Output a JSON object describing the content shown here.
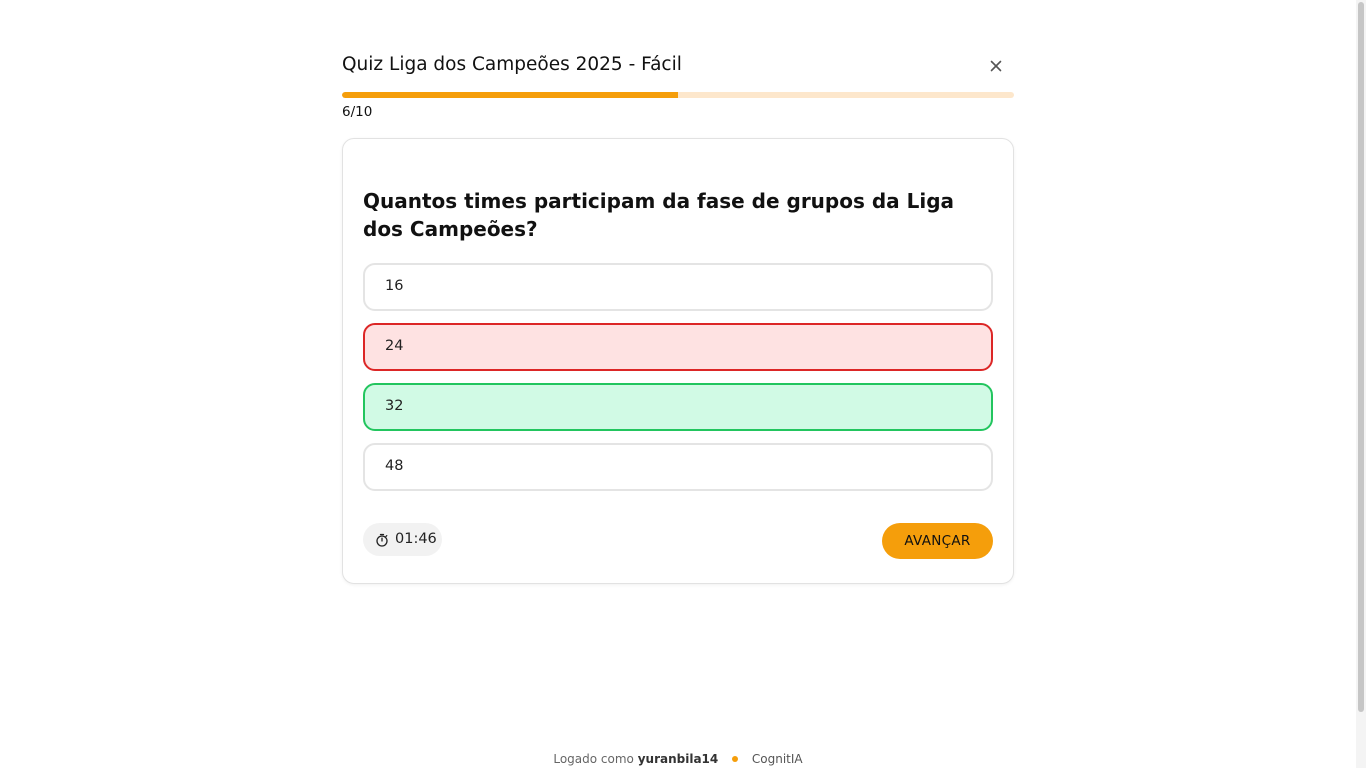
{
  "quiz": {
    "title": "Quiz Liga dos Campeões 2025 - Fácil",
    "progress_label": "6/10",
    "progress_fraction": 0.5
  },
  "question": {
    "text": "Quantos times participam da fase de grupos da Liga dos Campeões?",
    "options": [
      {
        "label": "16",
        "state": "neutral"
      },
      {
        "label": "24",
        "state": "wrong"
      },
      {
        "label": "32",
        "state": "correct"
      },
      {
        "label": "48",
        "state": "neutral"
      }
    ]
  },
  "timer": {
    "icon": "stopwatch-icon",
    "value": "01:46"
  },
  "actions": {
    "advance_label": "AVANÇAR"
  },
  "footer": {
    "logged_as_prefix": "Logado como",
    "username": "yuranbila14",
    "brand": "CognitIA"
  },
  "colors": {
    "accent": "#f59e0b",
    "wrong_bg": "#fee2e2",
    "wrong_border": "#dc2626",
    "correct_bg": "#d1fae5",
    "correct_border": "#22c55e"
  }
}
